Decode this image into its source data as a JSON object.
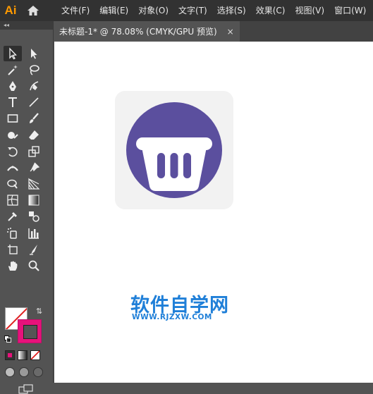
{
  "app": {
    "logo": "Ai"
  },
  "menu": {
    "items": [
      {
        "label": "文件(F)"
      },
      {
        "label": "编辑(E)"
      },
      {
        "label": "对象(O)"
      },
      {
        "label": "文字(T)"
      },
      {
        "label": "选择(S)"
      },
      {
        "label": "效果(C)"
      },
      {
        "label": "视图(V)"
      },
      {
        "label": "窗口(W)"
      }
    ]
  },
  "toolbar": {
    "collapse_label": "◂◂",
    "rows": [
      [
        "selection-tool-icon",
        "direct-selection-tool-icon"
      ],
      [
        "magic-wand-tool-icon",
        "lasso-tool-icon"
      ],
      [
        "pen-tool-icon",
        "curvature-tool-icon"
      ],
      [
        "type-tool-icon",
        "line-segment-tool-icon"
      ],
      [
        "rectangle-tool-icon",
        "paintbrush-tool-icon"
      ],
      [
        "shaper-tool-icon",
        "eraser-tool-icon"
      ],
      [
        "rotate-tool-icon",
        "scale-tool-icon"
      ],
      [
        "width-tool-icon",
        "puppet-warp-tool-icon"
      ],
      [
        "shape-builder-tool-icon",
        "perspective-grid-tool-icon"
      ],
      [
        "mesh-tool-icon",
        "gradient-tool-icon"
      ],
      [
        "eyedropper-tool-icon",
        "blend-tool-icon"
      ],
      [
        "symbol-sprayer-tool-icon",
        "column-graph-tool-icon"
      ],
      [
        "artboard-tool-icon",
        "slice-tool-icon"
      ],
      [
        "hand-tool-icon",
        "zoom-tool-icon"
      ]
    ],
    "fill_color": "#ffffff",
    "stroke_color": "#e7127b"
  },
  "document": {
    "tab_title": "未标题-1* @ 78.08% (CMYK/GPU 预览)",
    "close_label": "×"
  },
  "artwork": {
    "background_color": "#f2f2f2",
    "circle_color": "#5b4f9e",
    "basket_color": "#ffffff"
  },
  "watermark": {
    "chinese": "软件自学网",
    "url": "WWW.RJZXW.COM",
    "color": "#1f7fd8"
  }
}
